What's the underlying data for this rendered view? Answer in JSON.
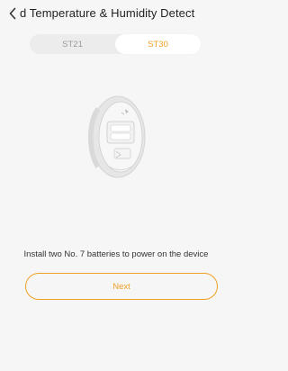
{
  "header": {
    "back_icon": "chevron-left-icon",
    "title": "d Temperature & Humidity Detect"
  },
  "model_tabs": [
    {
      "label": "ST21",
      "selected": false
    },
    {
      "label": "ST30",
      "selected": true
    }
  ],
  "device_image": "thermometer-sensor-battery-view",
  "instruction": "Install two No. 7 batteries to power on the device",
  "next_label": "Next",
  "colors": {
    "accent": "#f0a026",
    "background": "#f6f6f6",
    "segment_bg": "#ececec",
    "inactive_tab_text": "#9a9a9a"
  }
}
